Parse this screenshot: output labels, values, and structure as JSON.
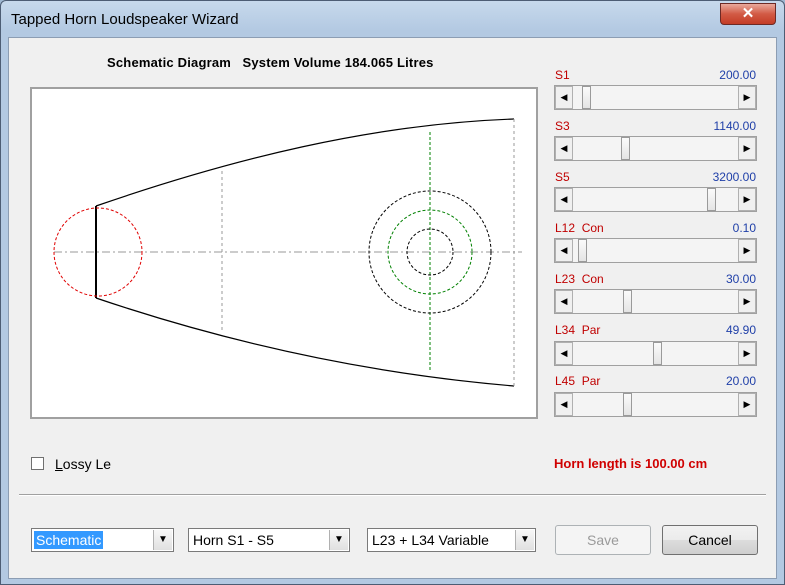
{
  "window": {
    "title": "Tapped Horn Loudspeaker Wizard",
    "close_glyph": "✕"
  },
  "diagram": {
    "caption": "Schematic Diagram   System Volume 184.065 Litres"
  },
  "sliders": [
    {
      "label": "S1",
      "value": "200.00",
      "thumb_position_fraction": 0.06
    },
    {
      "label": "S3",
      "value": "1140.00",
      "thumb_position_fraction": 0.31
    },
    {
      "label": "S5",
      "value": "3200.00",
      "thumb_position_fraction": 0.86
    },
    {
      "label": "L12  Con",
      "value": "0.10",
      "thumb_position_fraction": 0.03
    },
    {
      "label": "L23  Con",
      "value": "30.00",
      "thumb_position_fraction": 0.32
    },
    {
      "label": "L34  Par",
      "value": "49.90",
      "thumb_position_fraction": 0.51
    },
    {
      "label": "L45  Par",
      "value": "20.00",
      "thumb_position_fraction": 0.32
    }
  ],
  "arrows": {
    "left": "◀",
    "right": "▶",
    "down": "▼"
  },
  "options": {
    "lossy_label": "Lossy Le",
    "lossy_checked": false
  },
  "status": {
    "horn_length": "Horn length is 100.00 cm"
  },
  "controls": {
    "view_select": "Schematic",
    "horn_select": "Horn S1 - S5",
    "variable_select": "L23 + L34 Variable",
    "save_label": "Save",
    "cancel_label": "Cancel"
  },
  "colors": {
    "label_red": "#c00000",
    "value_blue": "#1f3fa8",
    "status_red": "#d00000"
  }
}
